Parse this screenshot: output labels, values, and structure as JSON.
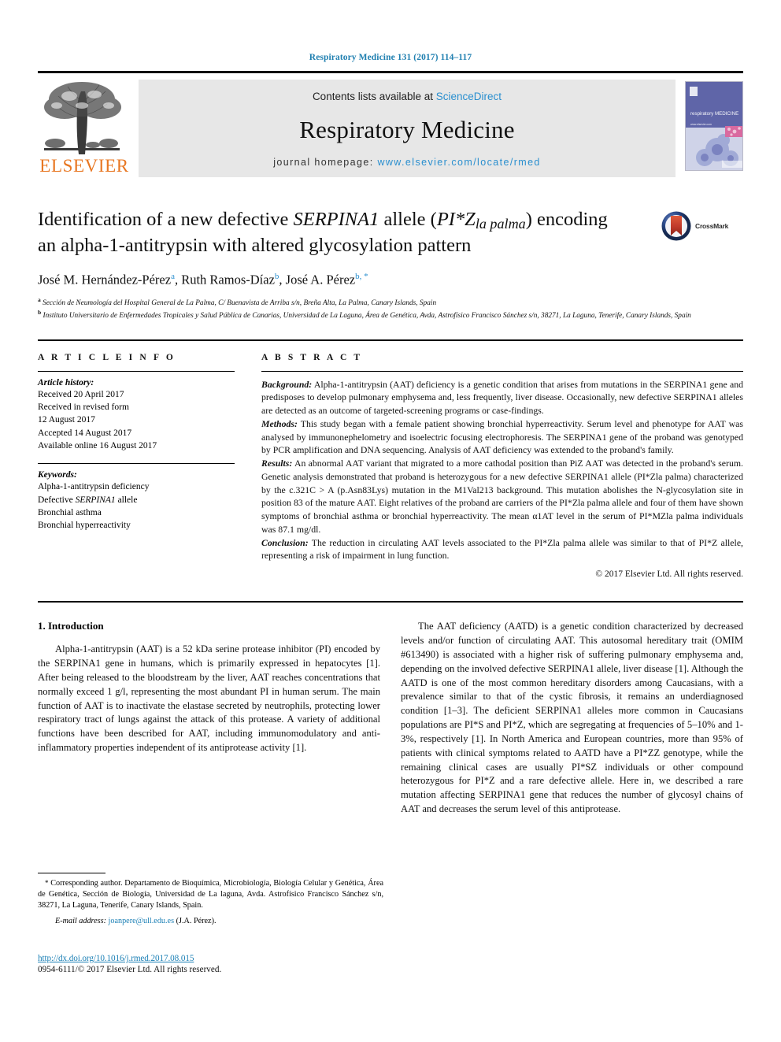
{
  "running_head": "Respiratory Medicine 131 (2017) 114–117",
  "masthead": {
    "contents_prefix": "Contents lists available at ",
    "sciencedirect": "ScienceDirect",
    "journal_title": "Respiratory Medicine",
    "homepage_prefix": "journal homepage: ",
    "homepage_url": "www.elsevier.com/locate/rmed",
    "publisher": "ELSEVIER",
    "cover_journal_name": "respiratory MEDICINE",
    "cover_url_text": "www.elsevier.com"
  },
  "crossmark": {
    "label": "CrossMark"
  },
  "article": {
    "title_line1_a": "Identification of a new defective ",
    "title_line1_italic": "SERPINA1",
    "title_line1_b": " allele (",
    "title_pi": "PI*Z",
    "title_sub": "la palma",
    "title_line1_c": ") encoding",
    "title_line2": "an alpha-1-antitrypsin with altered glycosylation pattern",
    "authors_plain": "José M. Hernández-Pérez a, Ruth Ramos-Díaz b, José A. Pérez b, *",
    "author1": "José M. Hernández-Pérez",
    "author1_mark": "a",
    "author2": "Ruth Ramos-Díaz",
    "author2_mark": "b",
    "author3": "José A. Pérez",
    "author3_mark": "b, *",
    "affiliation_a_mark": "a",
    "affiliation_a": "Sección de Neumología del Hospital General de La Palma, C/ Buenavista de Arriba s/n, Breña Alta, La Palma, Canary Islands, Spain",
    "affiliation_b_mark": "b",
    "affiliation_b": "Instituto Universitario de Enfermedades Tropicales y Salud Pública de Canarias, Universidad de La Laguna, Área de Genética, Avda, Astrofísico Francisco Sánchez s/n, 38271, La Laguna, Tenerife, Canary Islands, Spain"
  },
  "article_info": {
    "heading": "A R T I C L E  I N F O",
    "history_label": "Article history:",
    "history": [
      "Received 20 April 2017",
      "Received in revised form",
      "12 August 2017",
      "Accepted 14 August 2017",
      "Available online 16 August 2017"
    ],
    "keywords_label": "Keywords:",
    "keywords": [
      "Alpha-1-antitrypsin deficiency",
      "Defective SERPINA1 allele",
      "Bronchial asthma",
      "Bronchial hyperreactivity"
    ]
  },
  "abstract": {
    "heading": "A B S T R A C T",
    "background_label": "Background:",
    "background_text": " Alpha-1-antitrypsin (AAT) deficiency is a genetic condition that arises from mutations in the SERPINA1 gene and predisposes to develop pulmonary emphysema and, less frequently, liver disease. Occasionally, new defective SERPINA1 alleles are detected as an outcome of targeted-screening programs or case-findings.",
    "methods_label": "Methods:",
    "methods_text": " This study began with a female patient showing bronchial hyperreactivity. Serum level and phenotype for AAT was analysed by immunonephelometry and isoelectric focusing electrophoresis. The SERPINA1 gene of the proband was genotyped by PCR amplification and DNA sequencing. Analysis of AAT deficiency was extended to the proband's family.",
    "results_label": "Results:",
    "results_text": " An abnormal AAT variant that migrated to a more cathodal position than PiZ AAT was detected in the proband's serum. Genetic analysis demonstrated that proband is heterozygous for a new defective SERPINA1 allele (PI*Zla palma) characterized by the c.321C > A (p.Asn83Lys) mutation in the M1Val213 background. This mutation abolishes the N-glycosylation site in position 83 of the mature AAT. Eight relatives of the proband are carriers of the PI*Zla palma allele and four of them have shown symptoms of bronchial asthma or bronchial hyperreactivity. The mean α1AT level in the serum of PI*MZla palma individuals was 87.1 mg/dl.",
    "conclusion_label": "Conclusion:",
    "conclusion_text": " The reduction in circulating AAT levels associated to the PI*Zla palma allele was similar to that of PI*Z allele, representing a risk of impairment in lung function.",
    "copyright": "© 2017 Elsevier Ltd. All rights reserved."
  },
  "body": {
    "intro_heading": "1. Introduction",
    "left_paragraph": "Alpha-1-antitrypsin (AAT) is a 52 kDa serine protease inhibitor (PI) encoded by the SERPINA1 gene in humans, which is primarily expressed in hepatocytes [1]. After being released to the bloodstream by the liver, AAT reaches concentrations that normally exceed 1 g/l, representing the most abundant PI in human serum. The main function of AAT is to inactivate the elastase secreted by neutrophils, protecting lower respiratory tract of lungs against the attack of this protease. A variety of additional functions have been described for AAT, including immunomodulatory and anti-inflammatory properties independent of its antiprotease activity [1].",
    "right_paragraph": "The AAT deficiency (AATD) is a genetic condition characterized by decreased levels and/or function of circulating AAT. This autosomal hereditary trait (OMIM #613490) is associated with a higher risk of suffering pulmonary emphysema and, depending on the involved defective SERPINA1 allele, liver disease [1]. Although the AATD is one of the most common hereditary disorders among Caucasians, with a prevalence similar to that of the cystic fibrosis, it remains an underdiagnosed condition [1–3]. The deficient SERPINA1 alleles more common in Caucasians populations are PI*S and PI*Z, which are segregating at frequencies of 5–10% and 1-3%, respectively [1]. In North America and European countries, more than 95% of patients with clinical symptoms related to AATD have a PI*ZZ genotype, while the remaining clinical cases are usually PI*SZ individuals or other compound heterozygous for PI*Z and a rare defective allele. Here in, we described a rare mutation affecting SERPINA1 gene that reduces the number of glycosyl chains of AAT and decreases the serum level of this antiprotease."
  },
  "footer": {
    "corresponding_star": "*",
    "corresponding_text": " Corresponding author. Departamento de Bioquímica, Microbiología, Biología Celular y Genética, Área de Genética, Sección de Biología, Universidad de La laguna, Avda. Astrofísico Francisco Sánchez s/n, 38271, La Laguna, Tenerife, Canary Islands, Spain.",
    "email_label": "E-mail address:",
    "email": "joanpere@ull.edu.es",
    "email_suffix": " (J.A. Pérez).",
    "doi": "http://dx.doi.org/10.1016/j.rmed.2017.08.015",
    "issn_copyright": "0954-6111/© 2017 Elsevier Ltd. All rights reserved."
  },
  "colors": {
    "link": "#1a7fb5",
    "sciencedirect": "#2a8fcf",
    "elsevier_orange": "#E87722",
    "banner_bg": "#e7e7e7",
    "crossmark_red": "#c0392b",
    "crossmark_blue": "#2b4a8b"
  }
}
